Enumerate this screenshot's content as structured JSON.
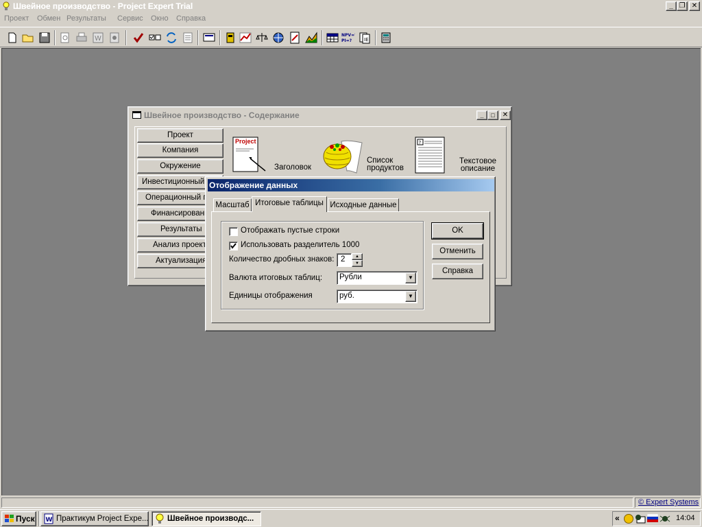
{
  "app": {
    "title": "Швейное производство - Project Expert Trial",
    "menu": [
      "Проект",
      "Обмен",
      "Результаты",
      "Сервис",
      "Окно",
      "Справка"
    ]
  },
  "contents_window": {
    "title": "Швейное производство - Содержание",
    "nav": [
      "Проект",
      "Компания",
      "Окружение",
      "Инвестиционный план",
      "Операционный план",
      "Финансирование",
      "Результаты",
      "Анализ проекта",
      "Актуализация"
    ],
    "icons": [
      {
        "label": "Заголовок",
        "badge": "Project"
      },
      {
        "label": "Список продуктов"
      },
      {
        "label": "Текстовое описание"
      }
    ]
  },
  "dialog": {
    "title": "Отображение данных",
    "tabs": [
      "Масштаб",
      "Итоговые таблицы",
      "Исходные данные"
    ],
    "active_tab": "Итоговые таблицы",
    "show_empty_rows_label": "Отображать пустые строки",
    "show_empty_rows": false,
    "use_separator_label": "Использовать разделитель 1000",
    "use_separator": true,
    "decimals_label": "Количество дробных знаков:",
    "decimals_value": "2",
    "currency_label": "Валюта итоговых таблиц:",
    "currency_value": "Рубли",
    "units_label": "Единицы отображения",
    "units_value": "руб.",
    "ok_label": "OK",
    "cancel_label": "Отменить",
    "help_label": "Справка"
  },
  "status": {
    "link": "© Expert Systems"
  },
  "taskbar": {
    "start_label": "Пуск",
    "tasks": [
      "Практикум Project Expe...",
      "Швейное производс..."
    ],
    "clock": "14:04",
    "tray_chevron": "«"
  }
}
